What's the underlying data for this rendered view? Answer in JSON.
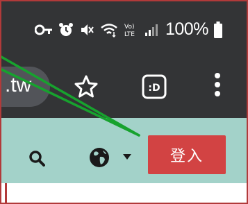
{
  "status_bar": {
    "battery_percent": "100%",
    "network_label": "LTE",
    "icons": [
      "key-icon",
      "alarm-icon",
      "mute-icon",
      "wifi-icon",
      "volte-icon",
      "signal-icon",
      "battery-icon"
    ]
  },
  "browser": {
    "url_fragment": ".tw",
    "tab_count_label": ":D",
    "icons": [
      "star-icon",
      "tab-switcher-icon",
      "more-menu-icon"
    ]
  },
  "site_header": {
    "login_label": "登入",
    "icons": [
      "search-icon",
      "globe-icon",
      "caret-down-icon"
    ],
    "colors": {
      "header_bg": "#a3d2c9",
      "login_bg": "#d24343"
    }
  },
  "annotation": {
    "color": "#17a22e"
  }
}
